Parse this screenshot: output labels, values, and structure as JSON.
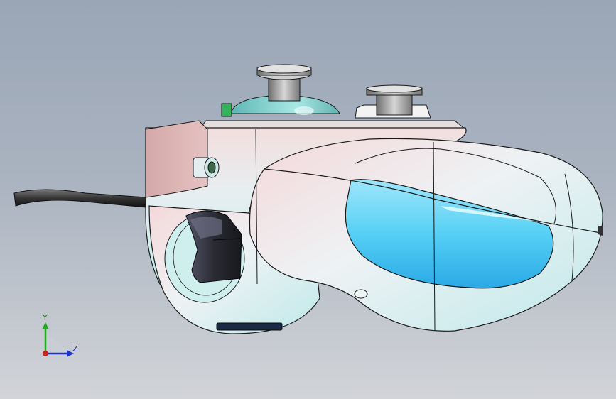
{
  "viewport": {
    "background_top": "#9aa6b6",
    "background_bottom": "#d2d4d8"
  },
  "model": {
    "body_color": "#d9ecec",
    "pink_tint": "#e9c9c9",
    "blue_panel": "#4fc8f2",
    "trigger_color": "#2c2d33",
    "teal_base": "#7fd0cc",
    "cable_color": "#3a3a3a",
    "edge_color": "#1a1a1a"
  },
  "triad": {
    "y_label": "Y",
    "z_label": "Z",
    "y_color": "#22aa22",
    "z_color": "#2233cc",
    "x_color": "#cc2222"
  }
}
